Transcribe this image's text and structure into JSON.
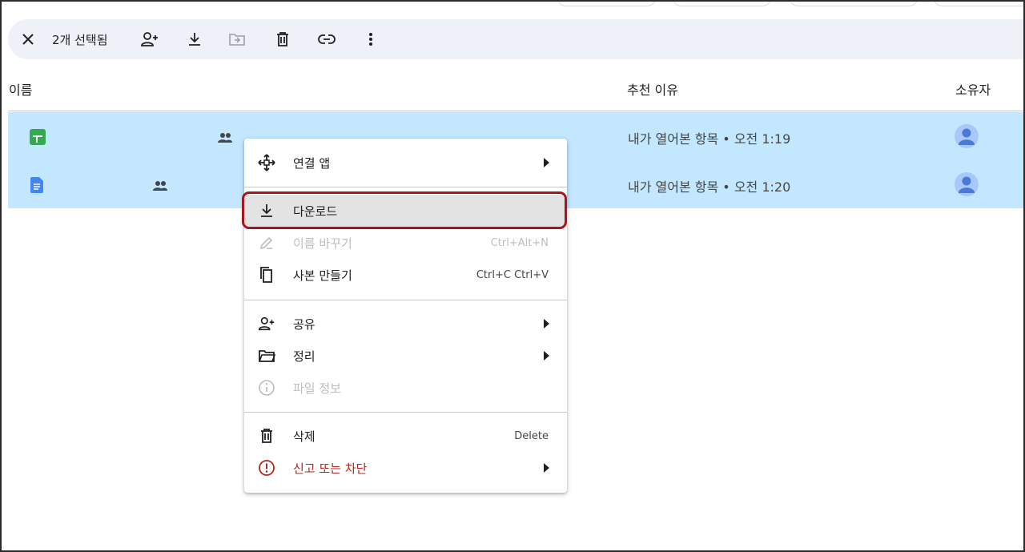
{
  "toolbar": {
    "selection_count": "2개 선택됨",
    "icons": [
      "close-icon",
      "share-icon",
      "download-icon",
      "move-icon",
      "trash-icon",
      "link-icon",
      "more-vert-icon"
    ]
  },
  "columns": {
    "name": "이름",
    "reason": "추천 이유",
    "owner": "소유자"
  },
  "files": [
    {
      "type": "sheets",
      "icon": "sheets-file-icon",
      "reason": "내가 열어본 항목 • 오전 1:19",
      "shared": true
    },
    {
      "type": "docs",
      "icon": "docs-file-icon",
      "reason": "내가 열어본 항목 • 오전 1:20",
      "shared": true
    }
  ],
  "context_menu": {
    "items": [
      {
        "label": "연결 앱",
        "icon": "open-with-icon",
        "has_submenu": true
      },
      {
        "label": "다운로드",
        "icon": "download-icon",
        "highlighted": true
      },
      {
        "label": "이름 바꾸기",
        "icon": "rename-pencil-icon",
        "shortcut": "Ctrl+Alt+N",
        "disabled": true
      },
      {
        "label": "사본 만들기",
        "icon": "copy-icon",
        "shortcut": "Ctrl+C Ctrl+V"
      },
      {
        "label": "공유",
        "icon": "share-icon",
        "has_submenu": true
      },
      {
        "label": "정리",
        "icon": "folder-icon",
        "has_submenu": true
      },
      {
        "label": "파일 정보",
        "icon": "info-icon",
        "disabled": true
      },
      {
        "label": "삭제",
        "icon": "trash-icon",
        "shortcut": "Delete"
      },
      {
        "label": "신고 또는 차단",
        "icon": "report-icon",
        "has_submenu": true,
        "danger": true
      }
    ]
  },
  "colors": {
    "selection_row": "#c2e7ff",
    "toolbar_bg": "#eef2f8",
    "highlight_ring": "#a8151b",
    "danger": "#b3261e",
    "sheets_green": "#34a853",
    "docs_blue": "#4285f4",
    "avatar_bg": "#a8c7fa",
    "avatar_fg": "#4a79d6"
  }
}
